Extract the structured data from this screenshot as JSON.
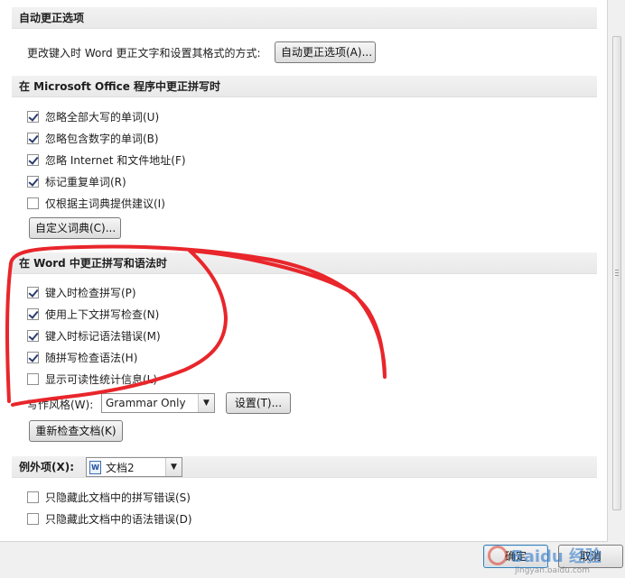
{
  "autocorrect": {
    "header": "自动更正选项",
    "description": "更改键入时 Word 更正文字和设置其格式的方式:",
    "button": "自动更正选项(A)..."
  },
  "office_spelling": {
    "header": "在 Microsoft Office 程序中更正拼写时",
    "options": [
      {
        "label": "忽略全部大写的单词(U)",
        "checked": true
      },
      {
        "label": "忽略包含数字的单词(B)",
        "checked": true
      },
      {
        "label": "忽略 Internet 和文件地址(F)",
        "checked": true
      },
      {
        "label": "标记重复单词(R)",
        "checked": true
      },
      {
        "label": "仅根据主词典提供建议(I)",
        "checked": false
      }
    ],
    "custom_dict_button": "自定义词典(C)..."
  },
  "word_spelling": {
    "header": "在 Word 中更正拼写和语法时",
    "options": [
      {
        "label": "键入时检查拼写(P)",
        "checked": true
      },
      {
        "label": "使用上下文拼写检查(N)",
        "checked": true
      },
      {
        "label": "键入时标记语法错误(M)",
        "checked": true
      },
      {
        "label": "随拼写检查语法(H)",
        "checked": true
      },
      {
        "label": "显示可读性统计信息(L)",
        "checked": false
      }
    ],
    "writing_style_label": "写作风格(W):",
    "writing_style_value": "Grammar Only",
    "settings_button": "设置(T)...",
    "recheck_button": "重新检查文档(K)"
  },
  "exceptions": {
    "label": "例外项(X):",
    "document_value": "文档2",
    "options": [
      {
        "label": "只隐藏此文档中的拼写错误(S)",
        "checked": false
      },
      {
        "label": "只隐藏此文档中的语法错误(D)",
        "checked": false
      }
    ]
  },
  "footer": {
    "ok": "确定",
    "cancel": "取消"
  },
  "watermark": {
    "brand": "Baidu 经验",
    "site": "jingyan.baidu.com"
  },
  "colors": {
    "annotation": "#e8262b",
    "section_bg": "#ececec",
    "check": "#2a3d6e"
  }
}
